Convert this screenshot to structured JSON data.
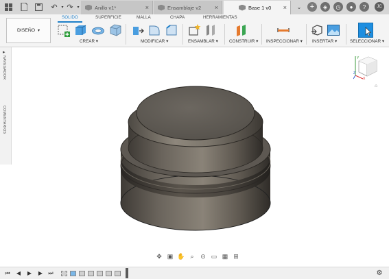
{
  "titlebar": {
    "tabs": [
      {
        "label": "Anillo v1*"
      },
      {
        "label": "Ensamblaje v2"
      },
      {
        "label": "Base 1 v0"
      }
    ],
    "close_glyph": "×",
    "icons": [
      "app-grid-icon",
      "file-icon",
      "save-icon",
      "undo-icon",
      "redo-icon",
      "new-tab-icon",
      "extensions-icon",
      "job-status-icon",
      "notifications-icon",
      "help-icon",
      "profile-icon"
    ],
    "profile_initials": "JC"
  },
  "toolbar": {
    "workspace_tabs": [
      "SOLIDO",
      "SUPERFICIE",
      "MALLA",
      "CHAPA",
      "HERRAMIENTAS"
    ],
    "active_tab": "SOLIDO",
    "design_button": "DISEÑO",
    "groups": [
      "CREAR",
      "MODIFICAR",
      "ENSAMBLAR",
      "CONSTRUIR",
      "INSPECCIONAR",
      "INSERTAR",
      "SELECCIONAR"
    ],
    "accent_color": "#1e7fc8"
  },
  "sidepanel": {
    "navigator": "NAVEGADOR",
    "comments": "COMENTARIOS"
  },
  "viewcube": {
    "x": "X",
    "y": "Y",
    "z": "Z"
  }
}
